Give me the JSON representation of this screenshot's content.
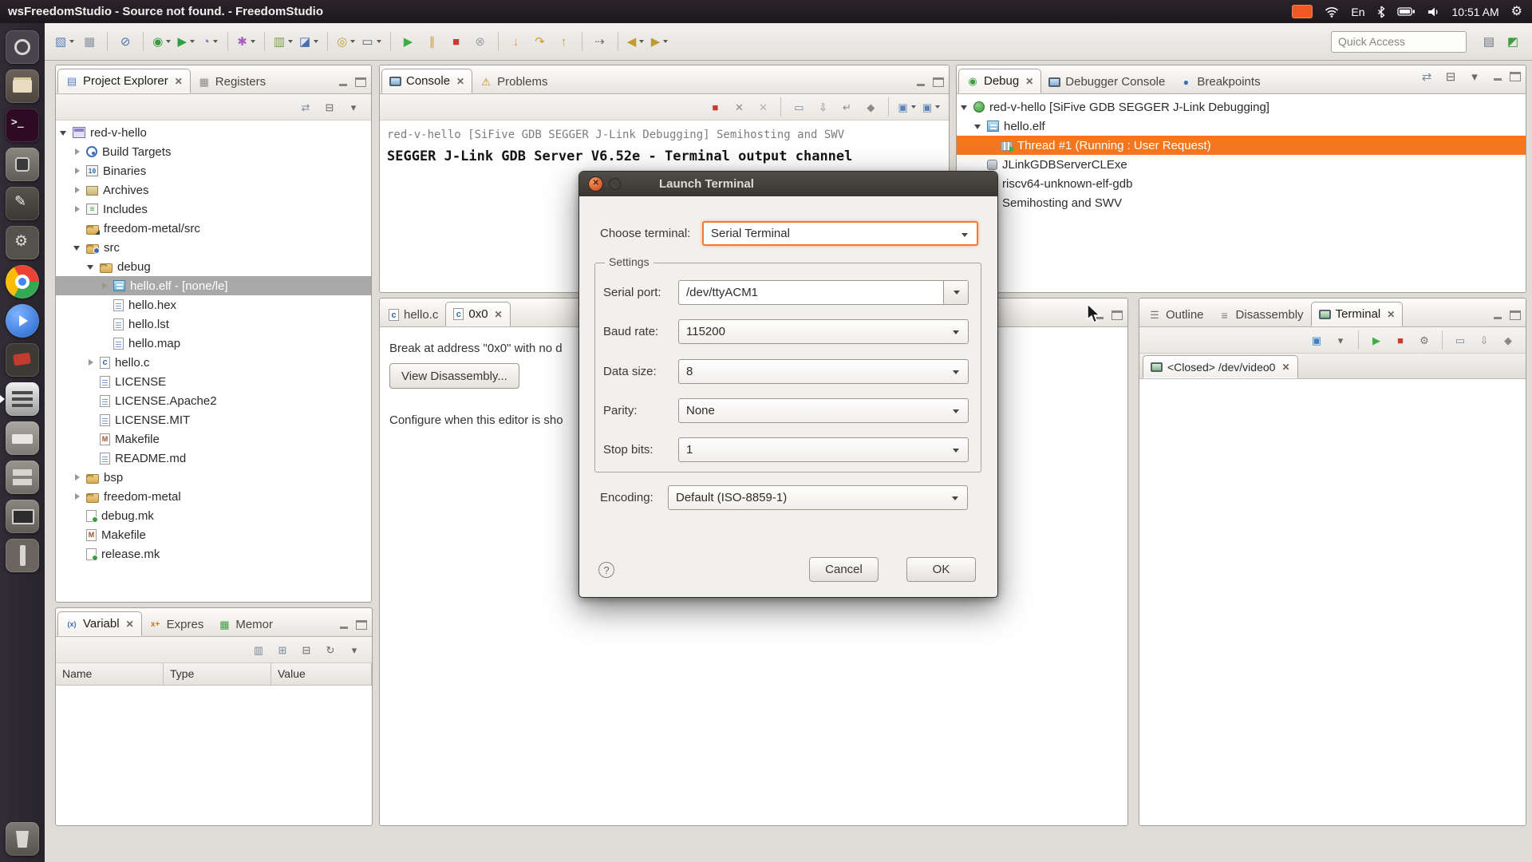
{
  "colors": {
    "ubuntu_orange": "#ef5a24",
    "selection_orange": "#f4771f",
    "selection_gray": "#a8a8a8",
    "focus_orange": "#ee7a33"
  },
  "system_bar": {
    "window_title": "wsFreedomStudio - Source not found. - FreedomStudio",
    "keyboard_layout": "En",
    "clock": "10:51 AM"
  },
  "launcher": {
    "items": [
      {
        "name": "dash"
      },
      {
        "name": "files"
      },
      {
        "name": "terminal"
      },
      {
        "name": "screenshot"
      },
      {
        "name": "gedit"
      },
      {
        "name": "system-settings"
      },
      {
        "name": "chrome"
      },
      {
        "name": "media-player"
      },
      {
        "name": "gimp"
      },
      {
        "name": "freedomstudio",
        "running": true
      },
      {
        "name": "printer"
      },
      {
        "name": "archive-manager"
      },
      {
        "name": "system-monitor"
      },
      {
        "name": "usb-creator"
      },
      {
        "name": "trash",
        "bottom": true
      }
    ]
  },
  "toolbar": {
    "quick_access_placeholder": "Quick Access",
    "items": [
      {
        "name": "new",
        "g": "▧",
        "c": "#5b7fbe",
        "dd": true
      },
      {
        "name": "save",
        "g": "▦",
        "c": "#8a93a0"
      },
      {
        "sep": true
      },
      {
        "name": "skip-all-breakpoints",
        "g": "⊘",
        "c": "#4a6fae"
      },
      {
        "sep": true
      },
      {
        "name": "debug",
        "g": "◉",
        "c": "#3f9b43",
        "dd": true
      },
      {
        "name": "run",
        "g": "▶",
        "c": "#2f9e44",
        "dd": true
      },
      {
        "name": "profile",
        "g": "◔",
        "c": "#8a5fb8",
        "dd": true
      },
      {
        "sep": true
      },
      {
        "name": "external-tools",
        "g": "✱",
        "c": "#a85fc4",
        "dd": true
      },
      {
        "sep": true
      },
      {
        "name": "coverage",
        "g": "▥",
        "c": "#7aa03f",
        "dd": true
      },
      {
        "name": "new-c-project",
        "g": "◪",
        "c": "#4a6fae",
        "dd": true
      },
      {
        "sep": true
      },
      {
        "name": "search",
        "g": "◎",
        "c": "#bf9b30",
        "dd": true
      },
      {
        "name": "open-terminal",
        "g": "▭",
        "c": "#55606b",
        "dd": true
      },
      {
        "sep": true
      },
      {
        "name": "resume",
        "g": "▶",
        "c": "#3fae49"
      },
      {
        "name": "suspend",
        "g": "∥",
        "c": "#cf9b2e"
      },
      {
        "name": "terminate",
        "g": "■",
        "c": "#c43c35"
      },
      {
        "name": "disconnect",
        "g": "⊗",
        "c": "#98a0a8"
      },
      {
        "sep": true
      },
      {
        "name": "step-into",
        "g": "↓",
        "c": "#cf9b2e"
      },
      {
        "name": "step-over",
        "g": "↷",
        "c": "#cf9b2e"
      },
      {
        "name": "step-return",
        "g": "↑",
        "c": "#cf9b2e"
      },
      {
        "sep": true
      },
      {
        "name": "instruction-stepping",
        "g": "⇢",
        "c": "#6b7684"
      },
      {
        "sep": true
      },
      {
        "name": "back",
        "g": "◀",
        "c": "#bf9b30",
        "dd": true
      },
      {
        "name": "forward",
        "g": "▶",
        "c": "#bf9b30",
        "dd": true
      }
    ],
    "right_items": [
      {
        "name": "open-perspective",
        "g": "▤",
        "c": "#6b7684"
      },
      {
        "name": "debug-perspective",
        "g": "◩",
        "c": "#3f9b43"
      }
    ]
  },
  "project_explorer": {
    "tabs": [
      {
        "label": "Project Explorer",
        "icon": "explorer",
        "active": true,
        "close": true
      },
      {
        "label": "Registers",
        "icon": "registers"
      }
    ],
    "toolbar": [
      {
        "name": "link-with-editor",
        "g": "⇄",
        "c": "#7a8699"
      },
      {
        "name": "collapse-all",
        "g": "⊟",
        "c": "#6b665f"
      },
      {
        "name": "view-menu",
        "g": "▾",
        "c": "#6b665f"
      }
    ],
    "tree": [
      {
        "label": "red-v-hello",
        "indent": 0,
        "arrow": "exp",
        "icon": "project"
      },
      {
        "label": "Build Targets",
        "indent": 1,
        "arrow": "col",
        "icon": "target"
      },
      {
        "label": "Binaries",
        "indent": 1,
        "arrow": "col",
        "icon": "binaries"
      },
      {
        "label": "Archives",
        "indent": 1,
        "arrow": "col",
        "icon": "archives"
      },
      {
        "label": "Includes",
        "indent": 1,
        "arrow": "col",
        "icon": "includes"
      },
      {
        "label": "freedom-metal/src",
        "indent": 1,
        "arrow": "none",
        "icon": "folder-link"
      },
      {
        "label": "src",
        "indent": 1,
        "arrow": "exp",
        "icon": "folder-src"
      },
      {
        "label": "debug",
        "indent": 2,
        "arrow": "exp",
        "icon": "folder"
      },
      {
        "label": "hello.elf - [none/le]",
        "indent": 3,
        "arrow": "col",
        "icon": "elf",
        "sel": "inactive"
      },
      {
        "label": "hello.hex",
        "indent": 3,
        "arrow": "none",
        "icon": "doc"
      },
      {
        "label": "hello.lst",
        "indent": 3,
        "arrow": "none",
        "icon": "doc"
      },
      {
        "label": "hello.map",
        "indent": 3,
        "arrow": "none",
        "icon": "doc"
      },
      {
        "label": "hello.c",
        "indent": 2,
        "arrow": "col",
        "icon": "cfile"
      },
      {
        "label": "LICENSE",
        "indent": 2,
        "arrow": "none",
        "icon": "doc"
      },
      {
        "label": "LICENSE.Apache2",
        "indent": 2,
        "arrow": "none",
        "icon": "doc"
      },
      {
        "label": "LICENSE.MIT",
        "indent": 2,
        "arrow": "none",
        "icon": "doc"
      },
      {
        "label": "Makefile",
        "indent": 2,
        "arrow": "none",
        "icon": "makefile"
      },
      {
        "label": "README.md",
        "indent": 2,
        "arrow": "none",
        "icon": "doc"
      },
      {
        "label": "bsp",
        "indent": 1,
        "arrow": "col",
        "icon": "folder"
      },
      {
        "label": "freedom-metal",
        "indent": 1,
        "arrow": "col",
        "icon": "folder"
      },
      {
        "label": "debug.mk",
        "indent": 1,
        "arrow": "none",
        "icon": "mkfile"
      },
      {
        "label": "Makefile",
        "indent": 1,
        "arrow": "none",
        "icon": "makefile"
      },
      {
        "label": "release.mk",
        "indent": 1,
        "arrow": "none",
        "icon": "mkfile"
      }
    ]
  },
  "variables": {
    "tabs": [
      {
        "label": "Variabl",
        "icon": "variables",
        "active": true,
        "close": true
      },
      {
        "label": "Expres",
        "icon": "expressions"
      },
      {
        "label": "Memor",
        "icon": "memory"
      }
    ],
    "toolbar": [
      {
        "name": "show-type-names",
        "g": "▥",
        "c": "#7a8699"
      },
      {
        "name": "show-logical-structure",
        "g": "⊞",
        "c": "#7a8699"
      },
      {
        "name": "collapse-all",
        "g": "⊟",
        "c": "#6b665f"
      },
      {
        "name": "refresh",
        "g": "↻",
        "c": "#6b665f"
      },
      {
        "name": "view-menu",
        "g": "▾",
        "c": "#6b665f"
      }
    ],
    "columns": [
      "Name",
      "Type",
      "Value"
    ]
  },
  "console": {
    "tabs": [
      {
        "label": "Console",
        "icon": "console",
        "active": true,
        "close": true
      },
      {
        "label": "Problems",
        "icon": "problems"
      }
    ],
    "toolbar": [
      {
        "name": "terminate",
        "g": "■",
        "c": "#c43c35"
      },
      {
        "name": "remove-launch",
        "g": "✕",
        "c": "#8a8a8a"
      },
      {
        "name": "remove-all-launches",
        "g": "✕",
        "c": "#b0b0b0"
      },
      {
        "sep": true
      },
      {
        "name": "clear-console",
        "g": "▭",
        "c": "#7a8699"
      },
      {
        "name": "scroll-lock",
        "g": "⇩",
        "c": "#8a8a8a"
      },
      {
        "name": "word-wrap",
        "g": "↵",
        "c": "#8a8a8a"
      },
      {
        "name": "pin-console",
        "g": "◆",
        "c": "#8a8a8a"
      },
      {
        "sep": true
      },
      {
        "name": "display-selected-console",
        "g": "▣",
        "c": "#5b82b8",
        "dd": true
      },
      {
        "name": "open-console",
        "g": "▣",
        "c": "#5b82b8",
        "dd": true
      }
    ],
    "header_line": "red-v-hello [SiFive GDB SEGGER J-Link Debugging] Semihosting and SWV",
    "output_line": "SEGGER J-Link GDB Server V6.52e - Terminal output channel"
  },
  "editor": {
    "tabs": [
      {
        "label": "hello.c",
        "icon": "cfile"
      },
      {
        "label": "0x0",
        "icon": "cfile",
        "active": true,
        "close": true
      }
    ],
    "message": "Break at address \"0x0\" with no d",
    "disassembly_button": "View Disassembly...",
    "note": "Configure when this editor is sho"
  },
  "debug": {
    "tabs": [
      {
        "label": "Debug",
        "icon": "debug",
        "active": true,
        "close": true
      },
      {
        "label": "Debugger Console",
        "icon": "console"
      },
      {
        "label": "Breakpoints",
        "icon": "breakpoints"
      }
    ],
    "toolbar": [
      {
        "name": "link-with-debug",
        "g": "⇄",
        "c": "#7a8699"
      },
      {
        "name": "collapse-all",
        "g": "⊟",
        "c": "#6b665f"
      },
      {
        "name": "view-menu",
        "g": "▾",
        "c": "#6b665f"
      }
    ],
    "tree": [
      {
        "label": "red-v-hello [SiFive GDB SEGGER J-Link Debugging]",
        "indent": 0,
        "arrow": "exp",
        "icon": "debug-target"
      },
      {
        "label": "hello.elf",
        "indent": 1,
        "arrow": "exp",
        "icon": "program"
      },
      {
        "label": "Thread #1 (Running : User Request)",
        "indent": 2,
        "arrow": "none",
        "icon": "thread",
        "sel": "active"
      },
      {
        "label": "JLinkGDBServerCLExe",
        "indent": 1,
        "arrow": "none",
        "icon": "process"
      },
      {
        "label": "riscv64-unknown-elf-gdb",
        "indent": 1,
        "arrow": "none",
        "icon": "process"
      },
      {
        "label": "Semihosting and SWV",
        "indent": 1,
        "arrow": "none",
        "icon": "process"
      }
    ]
  },
  "right_panel": {
    "tabs": [
      {
        "label": "Outline",
        "icon": "outline"
      },
      {
        "label": "Disassembly",
        "icon": "disassembly"
      },
      {
        "label": "Terminal",
        "icon": "terminal",
        "active": true,
        "close": true
      }
    ],
    "toolbar": [
      {
        "name": "open-terminal",
        "g": "▣",
        "c": "#3f7fbf"
      },
      {
        "name": "view-menu",
        "g": "▾",
        "c": "#6b665f"
      },
      {
        "sep": true
      },
      {
        "name": "connect",
        "g": "▶",
        "c": "#3fae49"
      },
      {
        "name": "disconnect",
        "g": "■",
        "c": "#c43c35"
      },
      {
        "name": "settings",
        "g": "⚙",
        "c": "#777777"
      },
      {
        "sep": true
      },
      {
        "name": "clear",
        "g": "▭",
        "c": "#7a8699"
      },
      {
        "name": "scroll-lock",
        "g": "⇩",
        "c": "#8a8a8a"
      },
      {
        "name": "pin",
        "g": "◆",
        "c": "#8a8a8a"
      }
    ],
    "terminal_tab": "<Closed> /dev/video0"
  },
  "dialog": {
    "title": "Launch Terminal",
    "choose_terminal": {
      "label": "Choose terminal:",
      "value": "Serial Terminal"
    },
    "settings_group": "Settings",
    "fields": [
      {
        "label": "Serial port:",
        "value": "/dev/ttyACM1",
        "editable": true
      },
      {
        "label": "Baud rate:",
        "value": "115200"
      },
      {
        "label": "Data size:",
        "value": "8"
      },
      {
        "label": "Parity:",
        "value": "None"
      },
      {
        "label": "Stop bits:",
        "value": "1"
      }
    ],
    "encoding": {
      "label": "Encoding:",
      "value": "Default (ISO-8859-1)"
    },
    "help": "?",
    "cancel": "Cancel",
    "ok": "OK"
  }
}
